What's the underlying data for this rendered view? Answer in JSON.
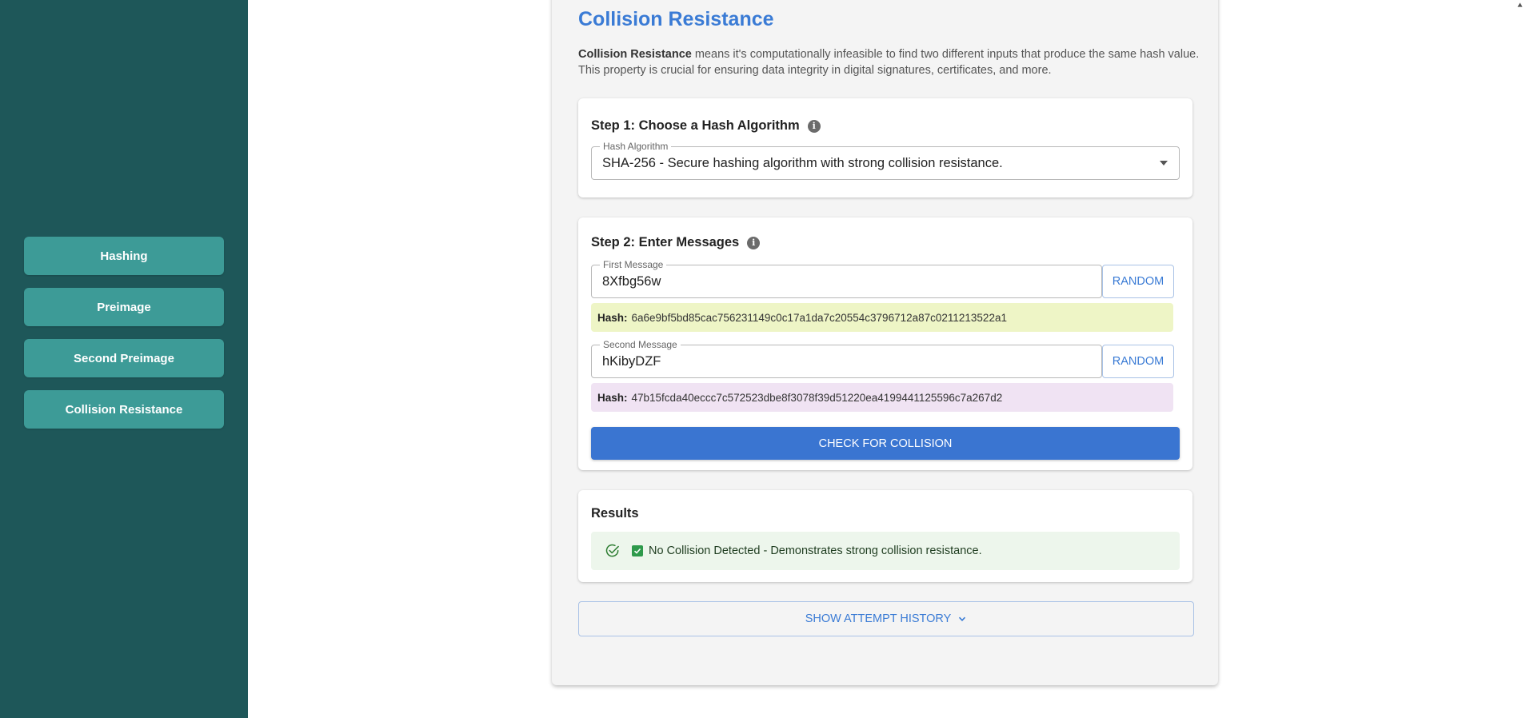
{
  "sidebar": {
    "items": [
      {
        "label": "Hashing"
      },
      {
        "label": "Preimage"
      },
      {
        "label": "Second Preimage"
      },
      {
        "label": "Collision Resistance"
      }
    ]
  },
  "main": {
    "title": "Collision Resistance",
    "intro_bold": "Collision Resistance",
    "intro_rest": " means it's computationally infeasible to find two different inputs that produce the same hash value. This property is crucial for ensuring data integrity in digital signatures, certificates, and more.",
    "step1": {
      "heading": "Step 1: Choose a Hash Algorithm",
      "field_label": "Hash Algorithm",
      "selected": "SHA-256 - Secure hashing algorithm with strong collision resistance."
    },
    "step2": {
      "heading": "Step 2: Enter Messages",
      "first": {
        "label": "First Message",
        "value": "8Xfbg56w",
        "random_label": "RANDOM",
        "hash_label": "Hash:",
        "hash": "6a6e9bf5bd85cac756231149c0c17a1da7c20554c3796712a87c0211213522a1",
        "hash_bg": "#eef5c6"
      },
      "second": {
        "label": "Second Message",
        "value": "hKibyDZF",
        "random_label": "RANDOM",
        "hash_label": "Hash:",
        "hash": "47b15fcda40eccc7c572523dbe8f3078f39d51220ea4199441125596c7a267d2",
        "hash_bg": "#f0e3f3"
      },
      "check_label": "CHECK FOR COLLISION"
    },
    "results": {
      "heading": "Results",
      "message": "No Collision Detected - Demonstrates strong collision resistance."
    },
    "history_label": "SHOW ATTEMPT HISTORY"
  },
  "colors": {
    "sidebar_bg": "#1e5759",
    "nav_button": "#3d9b97",
    "accent": "#3a7bd5",
    "primary_button": "#3a75d1",
    "success_bg": "#edf6ec",
    "success_check": "#2e9a4b"
  },
  "icons": [
    "info-icon",
    "dropdown-caret-icon",
    "check-circle-icon",
    "checkbox-checked-icon",
    "chevron-down-icon"
  ]
}
